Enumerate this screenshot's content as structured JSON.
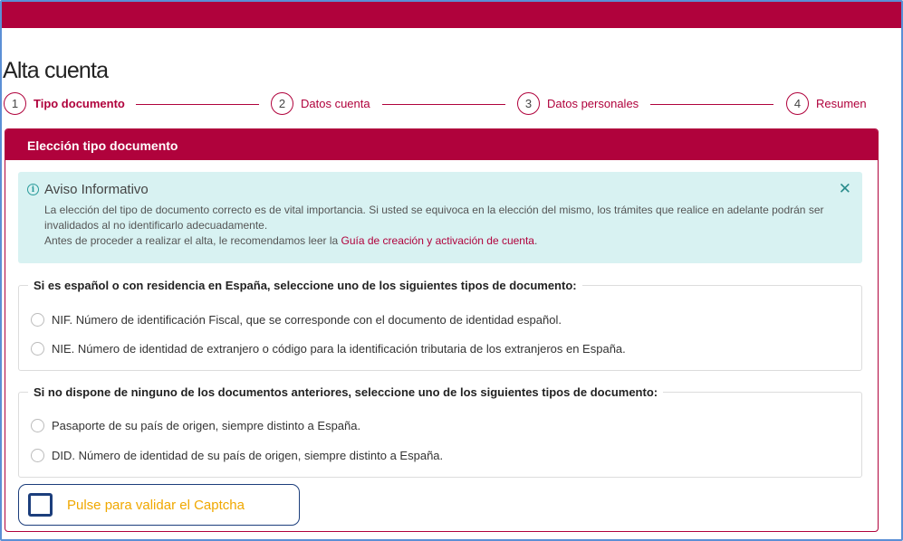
{
  "page": {
    "title": "Alta cuenta"
  },
  "stepper": {
    "steps": [
      {
        "number": "1",
        "label": "Tipo documento",
        "active": true
      },
      {
        "number": "2",
        "label": "Datos cuenta",
        "active": false
      },
      {
        "number": "3",
        "label": "Datos personales",
        "active": false
      },
      {
        "number": "4",
        "label": "Resumen",
        "active": false
      }
    ]
  },
  "card": {
    "title": "Elección tipo documento"
  },
  "alert": {
    "icon": "info-icon",
    "title": "Aviso Informativo",
    "close_icon": "close-icon",
    "line1": "La elección del tipo de documento correcto es de vital importancia. Si usted se equivoca en la elección del mismo, los trámites que realice en adelante podrán ser invalidados al no identificarlo adecuadamente.",
    "line2_prefix": "Antes de proceder a realizar el alta, le recomendamos leer la ",
    "link": "Guía de creación y activación de cuenta",
    "line2_suffix": "."
  },
  "groups": [
    {
      "legend": "Si es español o con residencia en España, seleccione uno de los siguientes tipos de documento:",
      "options": [
        "NIF. Número de identificación Fiscal, que se corresponde con el documento de identidad español.",
        "NIE. Número de identidad de extranjero o código para la identificación tributaria de los extranjeros en España."
      ]
    },
    {
      "legend": "Si no dispone de ninguno de los documentos anteriores, seleccione uno de los siguientes tipos de documento:",
      "options": [
        "Pasaporte de su país de origen, siempre distinto a España.",
        "DID. Número de identidad de su país de origen, siempre distinto a España."
      ]
    }
  ],
  "captcha": {
    "label": "Pulse para validar el Captcha"
  },
  "colors": {
    "brand": "#b0023c",
    "alert_bg": "#d8f2f2",
    "captcha_border": "#1c3e7c",
    "captcha_text": "#f0a800"
  }
}
